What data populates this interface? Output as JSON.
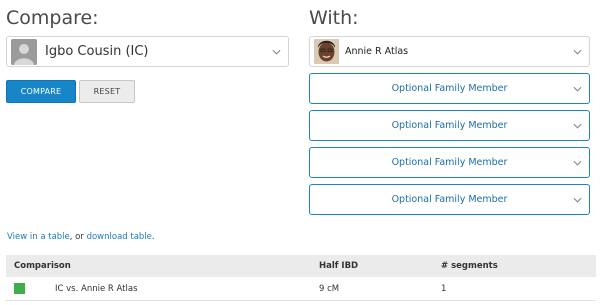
{
  "compare": {
    "heading": "Compare:",
    "person": "Igbo Cousin (IC)",
    "compare_button": "COMPARE",
    "reset_button": "RESET"
  },
  "with": {
    "heading": "With:",
    "person": "Annie R Atlas",
    "optional_members": [
      "Optional Family Member",
      "Optional Family Member",
      "Optional Family Member",
      "Optional Family Member"
    ]
  },
  "links": {
    "view_table": "View in a table",
    "separator": ", or ",
    "download_table": "download table",
    "end": "."
  },
  "results": {
    "columns": [
      "Comparison",
      "Half IBD",
      "# segments"
    ],
    "rows": [
      {
        "swatch_color": "#3fae49",
        "comparison": "IC  vs. Annie R Atlas",
        "half_ibd": "9 cM",
        "segments": "1"
      }
    ]
  },
  "colors": {
    "accent": "#1786c9",
    "border_active": "#1c85c8",
    "swatch": "#3fae49"
  }
}
